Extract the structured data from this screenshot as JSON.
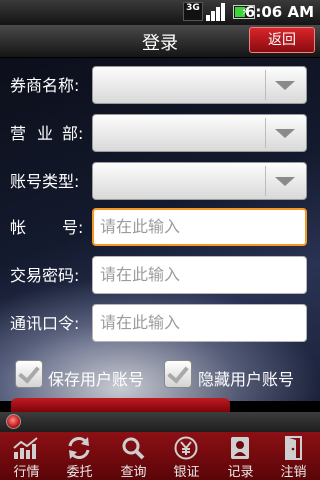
{
  "status_bar": {
    "network": "3G",
    "time": "6:06 AM"
  },
  "header": {
    "title": "登录",
    "back_label": "返回"
  },
  "form": {
    "broker": {
      "label": "券商名称:",
      "value": ""
    },
    "branch": {
      "label_a": "营",
      "label_b": "业",
      "label_c": "部:",
      "value": ""
    },
    "account_type": {
      "label": "账号类型:",
      "value": ""
    },
    "account": {
      "label_a": "帐",
      "label_b": "号:",
      "placeholder": "请在此输入"
    },
    "trade_password": {
      "label": "交易密码:",
      "placeholder": "请在此输入"
    },
    "comm_password": {
      "label": "通讯口令:",
      "placeholder": "请在此输入"
    },
    "save_account": {
      "label": "保存用户账号",
      "checked": true
    },
    "hide_account": {
      "label": "隐藏用户账号",
      "checked": true
    }
  },
  "tabs": [
    {
      "label": "行情",
      "icon": "chart-icon"
    },
    {
      "label": "委托",
      "icon": "refresh-icon"
    },
    {
      "label": "查询",
      "icon": "magnifier-icon"
    },
    {
      "label": "银证",
      "icon": "yuan-icon"
    },
    {
      "label": "记录",
      "icon": "contact-icon"
    },
    {
      "label": "注销",
      "icon": "exit-door-icon"
    }
  ],
  "colors": {
    "accent_red": "#c11a22",
    "focus_orange": "#f49a22"
  }
}
